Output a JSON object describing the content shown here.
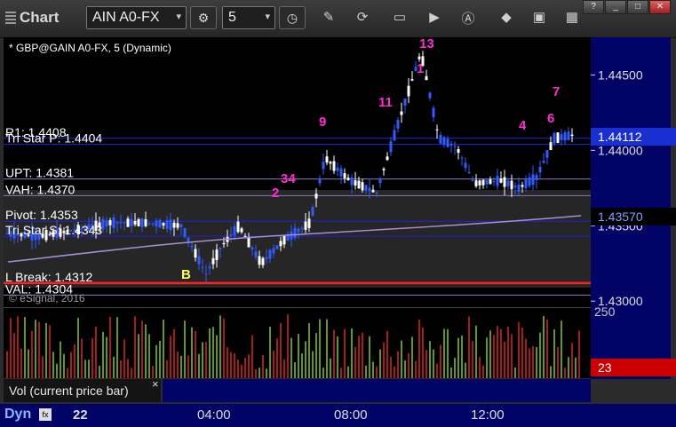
{
  "app": {
    "title": "Chart"
  },
  "toolbar": {
    "symbol": "AIN A0-FX",
    "interval": "5"
  },
  "chart_data": {
    "type": "candlestick",
    "title": "* GBP@GAIN A0-FX, 5 (Dynamic)",
    "watermark": "© eSignal, 2016",
    "ylim": [
      1.4296,
      1.4475
    ],
    "y_ticks": [
      "1.44500",
      "1.44000",
      "1.43500",
      "1.43000"
    ],
    "x_ticks": [
      "22",
      "04:00",
      "08:00",
      "12:00"
    ],
    "price_levels": [
      {
        "label": "R1: 1.4408",
        "value": 1.4408,
        "color": "#2222dd"
      },
      {
        "label": "Tri Star P: 1.4404",
        "value": 1.4404,
        "color": "#2222dd"
      },
      {
        "label": "UPT: 1.4381",
        "value": 1.4381,
        "color": "#8a78c8"
      },
      {
        "label": "VAH: 1.4370",
        "value": 1.437,
        "color": "#8a78c8"
      },
      {
        "label": "Pivot: 1.4353",
        "value": 1.4353,
        "color": "#2222dd"
      },
      {
        "label": "Tri Star S: 1.4343",
        "value": 1.4343,
        "color": "#2222dd"
      },
      {
        "label": "L Break: 1.4312",
        "value": 1.4312,
        "color": "#ff2020"
      },
      {
        "label": "VAL: 1.4304",
        "value": 1.4304,
        "color": "#8a78c8"
      }
    ],
    "current_price": {
      "value": 1.44112,
      "label": "1.44112"
    },
    "moving_average": {
      "value": 1.4357,
      "label": "1.43570"
    },
    "volume": {
      "name": "Vol (current price bar)",
      "axis_label": "250",
      "current": "23"
    },
    "annotations": [
      "13",
      "1",
      "7",
      "11",
      "9",
      "34",
      "2",
      "4",
      "6",
      "B"
    ]
  }
}
